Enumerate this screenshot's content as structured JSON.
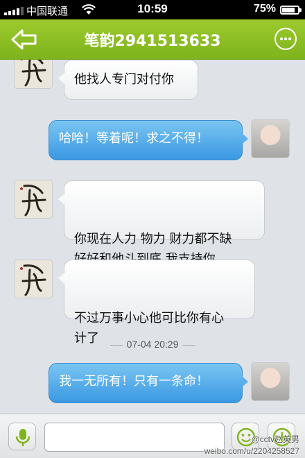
{
  "status_bar": {
    "carrier": "中国联通",
    "time": "10:59",
    "battery": "75%",
    "battery_level": 0.75
  },
  "nav": {
    "title": "笔韵2941513633",
    "back_icon": "back-arrow-icon",
    "more_icon": "more-dots-icon"
  },
  "messages": [
    {
      "from": "other",
      "text": "他找人专门对付你"
    },
    {
      "from": "me",
      "text": "哈哈！等着呢！求之不得！"
    },
    {
      "from": "other",
      "text": "你现在人力 物力 财力都不缺\n好好和他斗到底 我支持你"
    },
    {
      "from": "other",
      "text": "不过万事小心他可比你有心\n计了"
    },
    {
      "from": "me",
      "text": "我一无所有！只有一条命！"
    }
  ],
  "timestamp": "07-04 20:29",
  "input_bar": {
    "voice_icon": "microphone-icon",
    "emoji_icon": "smiley-icon",
    "plus_icon": "plus-icon",
    "placeholder": ""
  },
  "watermark": {
    "handle": "@cctv赵英男",
    "url": "weibo.com/u/2204258527"
  },
  "colors": {
    "nav_green": "#8cc026",
    "bubble_blue": "#4aa6e8"
  }
}
